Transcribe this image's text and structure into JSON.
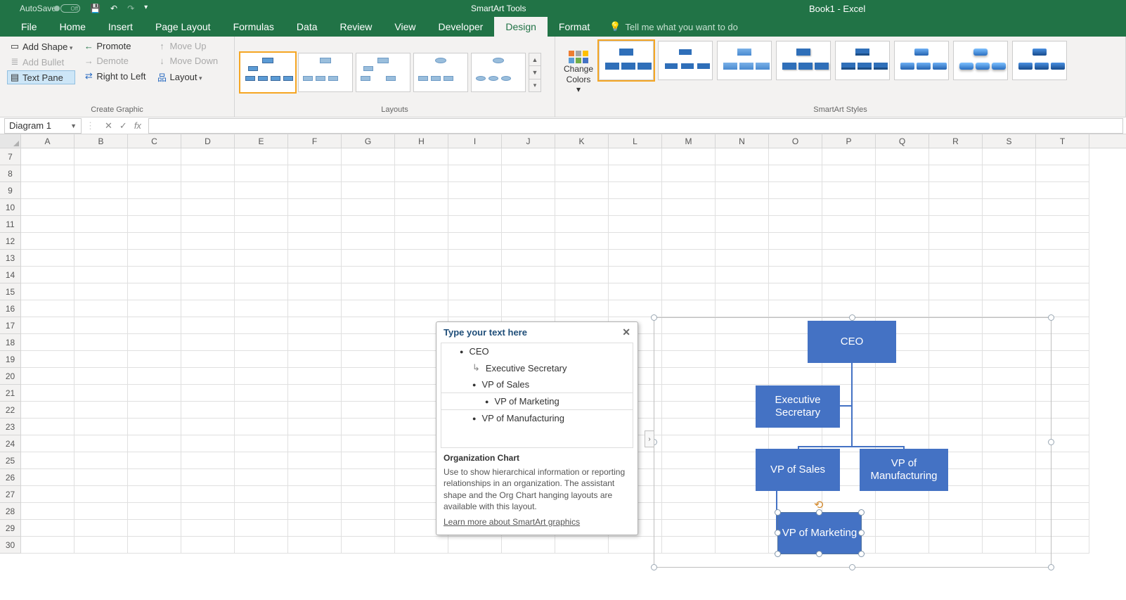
{
  "titlebar": {
    "autosave": "AutoSave",
    "toggle_state": "Off",
    "smartart_tools": "SmartArt Tools",
    "doc_title": "Book1  -  Excel"
  },
  "tabs": {
    "file": "File",
    "home": "Home",
    "insert": "Insert",
    "page_layout": "Page Layout",
    "formulas": "Formulas",
    "data": "Data",
    "review": "Review",
    "view": "View",
    "developer": "Developer",
    "design": "Design",
    "format": "Format",
    "tell_me": "Tell me what you want to do"
  },
  "ribbon": {
    "create_graphic": {
      "add_shape": "Add Shape",
      "add_bullet": "Add Bullet",
      "text_pane": "Text Pane",
      "promote": "Promote",
      "demote": "Demote",
      "right_to_left": "Right to Left",
      "move_up": "Move Up",
      "move_down": "Move Down",
      "layout": "Layout",
      "group_label": "Create Graphic"
    },
    "layouts_label": "Layouts",
    "change_colors": {
      "line1": "Change",
      "line2": "Colors"
    },
    "styles_label": "SmartArt Styles"
  },
  "formula_bar": {
    "name_box": "Diagram 1"
  },
  "columns": [
    "A",
    "B",
    "C",
    "D",
    "E",
    "F",
    "G",
    "H",
    "I",
    "J",
    "K",
    "L",
    "M",
    "N",
    "O",
    "P",
    "Q",
    "R",
    "S",
    "T"
  ],
  "rows": [
    7,
    8,
    9,
    10,
    11,
    12,
    13,
    14,
    15,
    16,
    17,
    18,
    19,
    20,
    21,
    22,
    23,
    24,
    25,
    26,
    27,
    28,
    29,
    30
  ],
  "text_pane": {
    "title": "Type your text here",
    "items": {
      "ceo": "CEO",
      "secretary": "Executive Secretary",
      "sales": "VP of Sales",
      "marketing": "VP of Marketing",
      "mfg": "VP of Manufacturing"
    },
    "footer_title": "Organization Chart",
    "footer_body": "Use to show hierarchical information or reporting relationships in an organization. The assistant shape and the Org Chart hanging layouts are available with this layout.",
    "footer_link": "Learn more about SmartArt graphics"
  },
  "org": {
    "ceo": "CEO",
    "secretary": "Executive Secretary",
    "sales": "VP of Sales",
    "mfg": "VP of Manufacturing",
    "marketing": "VP of Marketing"
  }
}
